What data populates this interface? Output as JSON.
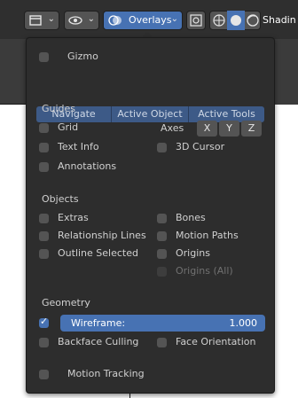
{
  "header": {
    "overlays_label": "Overlays",
    "shading_label": "Shadin",
    "icons": [
      "viewport-type-icon",
      "view-object-icon",
      "overlays-icon",
      "gizmo-icon",
      "wireframe-shading-icon",
      "solid-shading-icon",
      "material-shading-icon"
    ]
  },
  "popover": {
    "gizmo": {
      "label": "Gizmo",
      "checked": false
    },
    "tabs": [
      "Navigate",
      "Active Object",
      "Active Tools"
    ],
    "guides": {
      "title": "Guides",
      "grid": "Grid",
      "text_info": "Text Info",
      "annotations": "Annotations",
      "axes_label": "Axes",
      "axes": [
        "X",
        "Y",
        "Z"
      ],
      "cursor_3d": "3D Cursor"
    },
    "objects": {
      "title": "Objects",
      "extras": "Extras",
      "relationship_lines": "Relationship Lines",
      "outline_selected": "Outline Selected",
      "bones": "Bones",
      "motion_paths": "Motion Paths",
      "origins": "Origins",
      "origins_all": "Origins (All)"
    },
    "geometry": {
      "title": "Geometry",
      "wireframe_label": "Wireframe:",
      "wireframe_value": "1.000",
      "wireframe_checked": true,
      "backface_culling": "Backface Culling",
      "face_orientation": "Face Orientation"
    },
    "motion_tracking": "Motion Tracking"
  },
  "colors": {
    "accent": "#4772b3",
    "panel": "#2d2d2d",
    "header": "#2f2f2f"
  }
}
